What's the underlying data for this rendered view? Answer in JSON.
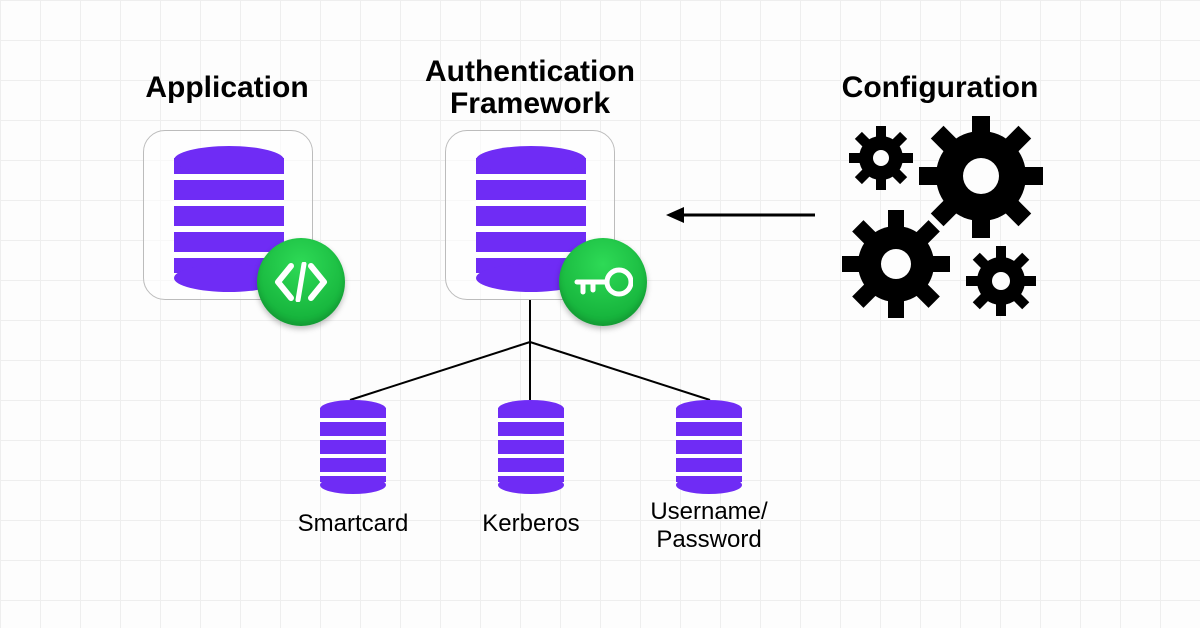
{
  "nodes": {
    "application": {
      "title": "Application"
    },
    "framework": {
      "title": "Authentication\nFramework"
    },
    "configuration": {
      "title": "Configuration"
    }
  },
  "children": {
    "smartcard": {
      "label": "Smartcard"
    },
    "kerberos": {
      "label": "Kerberos"
    },
    "userpass": {
      "label": "Username/\nPassword"
    }
  },
  "colors": {
    "db": "#6f2cf5",
    "badge": "#17b53d"
  }
}
